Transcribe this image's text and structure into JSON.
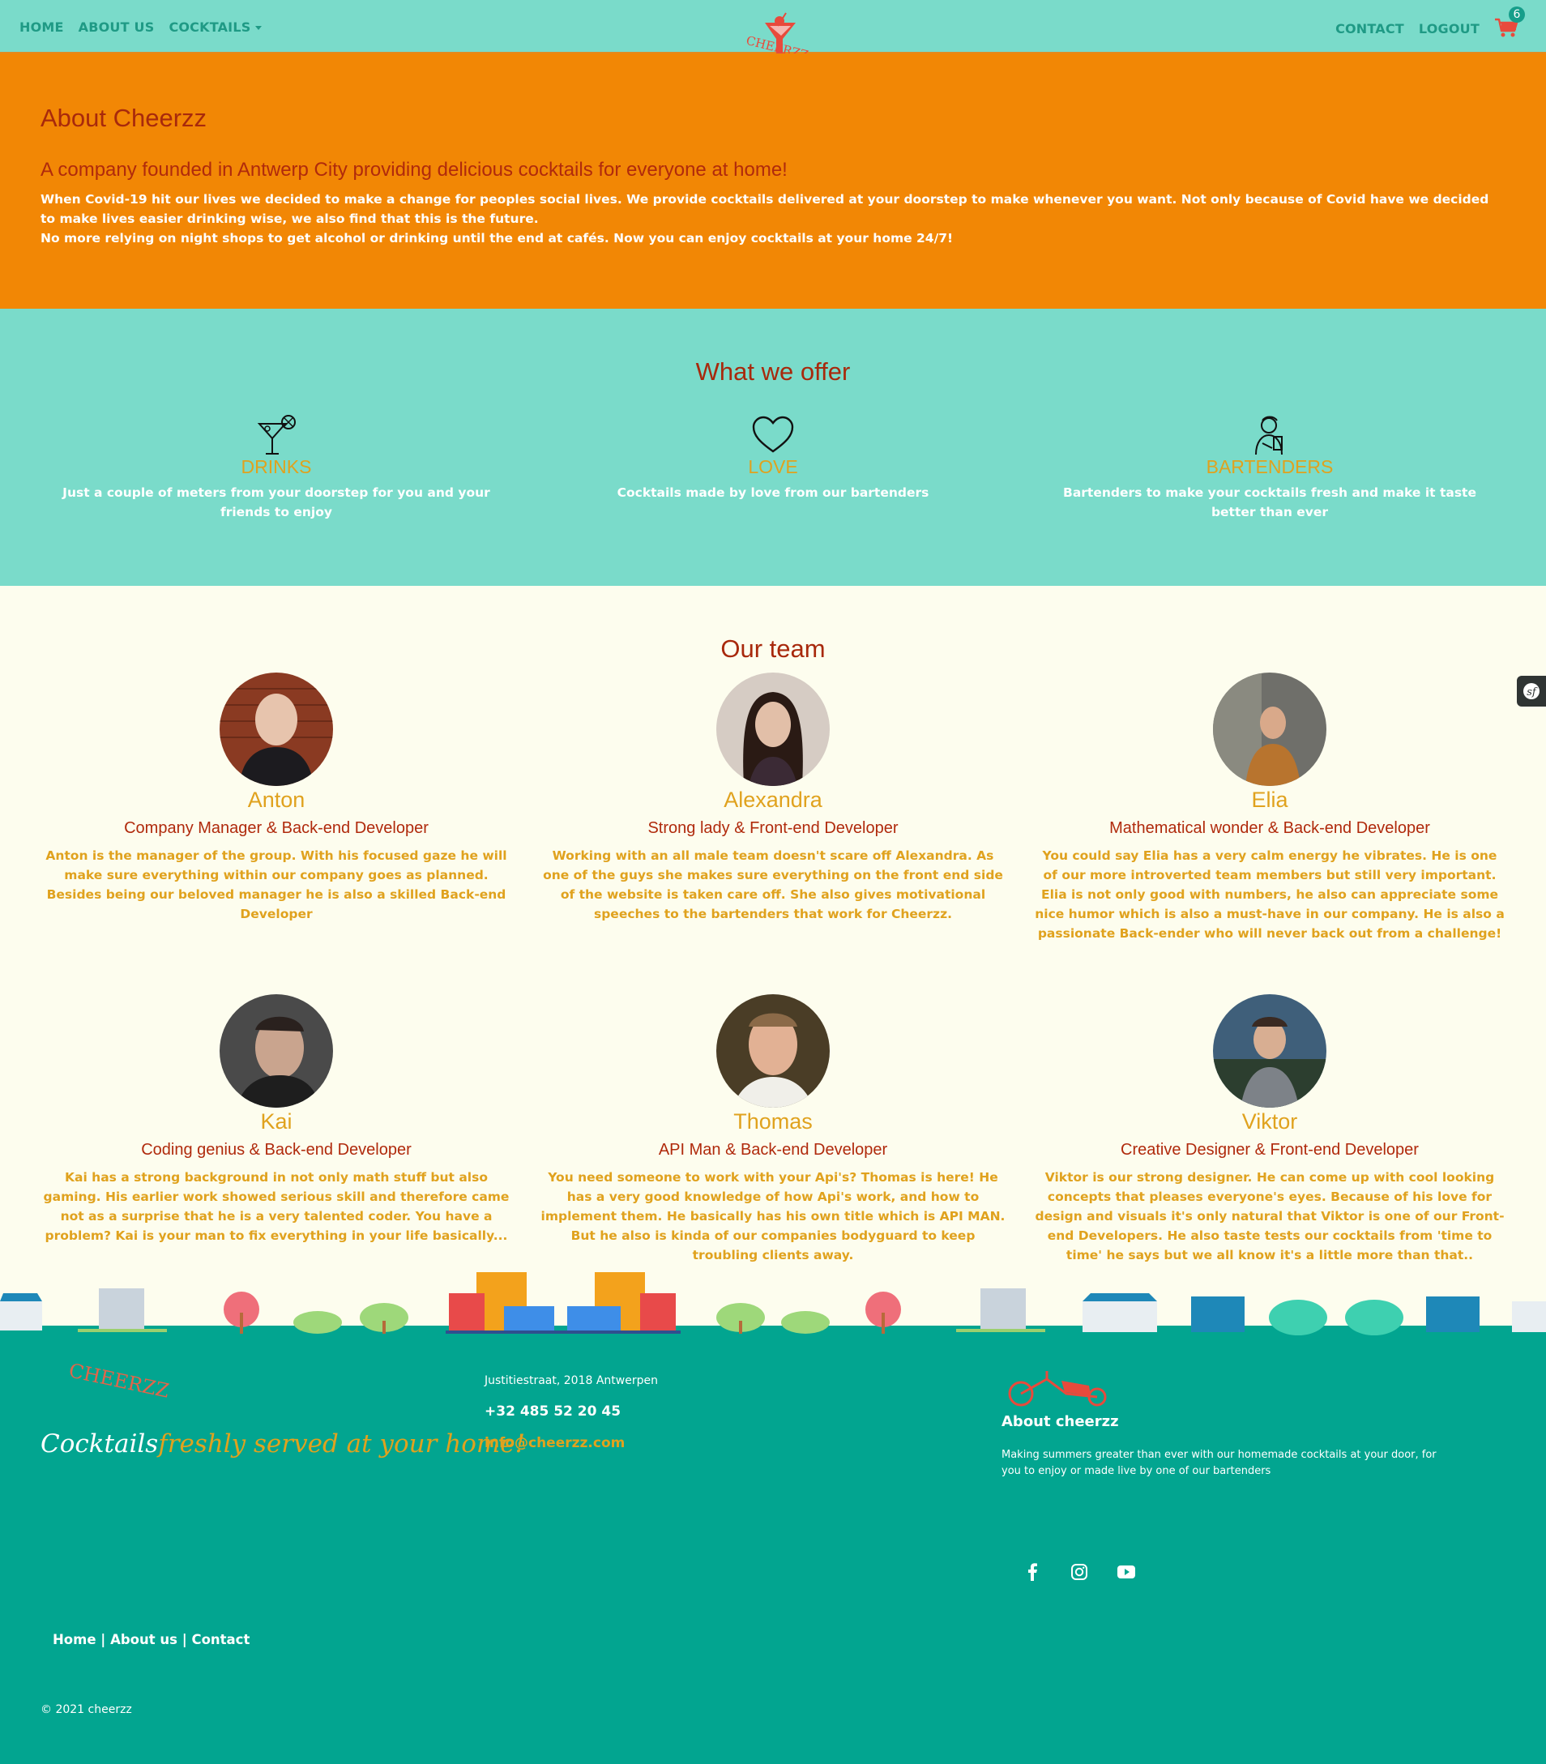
{
  "nav": {
    "home": "HOME",
    "about": "ABOUT US",
    "cocktails": "COCKTAILS",
    "contact": "CONTACT",
    "logout": "LOGOUT",
    "cart_count": "6",
    "logo_text": "CHEERZZ"
  },
  "about": {
    "title": "About Cheerzz",
    "subtitle": "A company founded in Antwerp City providing delicious cocktails for everyone at home!",
    "para1": "When Covid-19 hit our lives we decided to make a change for peoples social lives. We provide cocktails delivered at your doorstep to make whenever you want. Not only because of Covid have we decided to make lives easier drinking wise, we also find that this is the future.",
    "para2": "No more relying on night shops to get alcohol or drinking until the end at cafés. Now you can enjoy cocktails at your home 24/7!"
  },
  "offer": {
    "title": "What we offer",
    "items": [
      {
        "icon": "cocktail-glass-icon",
        "title": "DRINKS",
        "text": "Just a couple of meters from your doorstep for you and your friends to enjoy"
      },
      {
        "icon": "heart-icon",
        "title": "LOVE",
        "text": "Cocktails made by love from our bartenders"
      },
      {
        "icon": "bartender-icon",
        "title": "BARTENDERS",
        "text": "Bartenders to make your cocktails fresh and make it taste better than ever"
      }
    ]
  },
  "team": {
    "title": "Our team",
    "members": [
      {
        "name": "Anton",
        "role": "Company Manager & Back-end Developer",
        "bio": "Anton is the manager of the group. With his focused gaze he will make sure everything within our company goes as planned. Besides being our beloved manager he is also a skilled Back-end Developer"
      },
      {
        "name": "Alexandra",
        "role": "Strong lady & Front-end Developer",
        "bio": "Working with an all male team doesn't scare off Alexandra. As one of the guys she makes sure everything on the front end side of the website is taken care off. She also gives motivational speeches to the bartenders that work for Cheerzz."
      },
      {
        "name": "Elia",
        "role": "Mathematical wonder & Back-end Developer",
        "bio": "You could say Elia has a very calm energy he vibrates. He is one of our more introverted team members but still very important. Elia is not only good with numbers, he also can appreciate some nice humor which is also a must-have in our company. He is also a passionate Back-ender who will never back out from a challenge!"
      },
      {
        "name": "Kai",
        "role": "Coding genius & Back-end Developer",
        "bio": "Kai has a strong background in not only math stuff but also gaming. His earlier work showed serious skill and therefore came not as a surprise that he is a very talented coder. You have a problem? Kai is your man to fix everything in your life basically..."
      },
      {
        "name": "Thomas",
        "role": "API Man & Back-end Developer",
        "bio": "You need someone to work with your Api's? Thomas is here! He has a very good knowledge of how Api's work, and how to implement them. He basically has his own title which is API MAN. But he also is kinda of our companies bodyguard to keep troubling clients away."
      },
      {
        "name": "Viktor",
        "role": "Creative Designer & Front-end Developer",
        "bio": "Viktor is our strong designer. He can come up with cool looking concepts that pleases everyone's eyes. Because of his love for design and visuals it's only natural that Viktor is one of our Front-end Developers. He also taste tests our cocktails from 'time to time' he says but we all know it's a little more than that.."
      }
    ]
  },
  "footer": {
    "brand": "CHEERZZ",
    "tag_a": "Cocktails",
    "tag_b": "freshly served at your home!",
    "address": "Justitiestraat, 2018 Antwerpen",
    "phone": "+32 485 52 20 45",
    "email": "info@cheerzz.com",
    "about_title": "About cheerzz",
    "about_text": "Making summers greater than ever with our homemade cocktails at your door, for you to enjoy or made live by one of our bartenders",
    "link_home": "Home",
    "link_about": "About us",
    "link_contact": "Contact",
    "sep": "|",
    "copyright": "© 2021 cheerzz"
  },
  "colors": {
    "teal": "#7adbca",
    "orange": "#f28705",
    "dark_teal": "#02a590",
    "red": "#a8290c",
    "gold": "#e0a21e",
    "cream": "#fdfdee"
  }
}
